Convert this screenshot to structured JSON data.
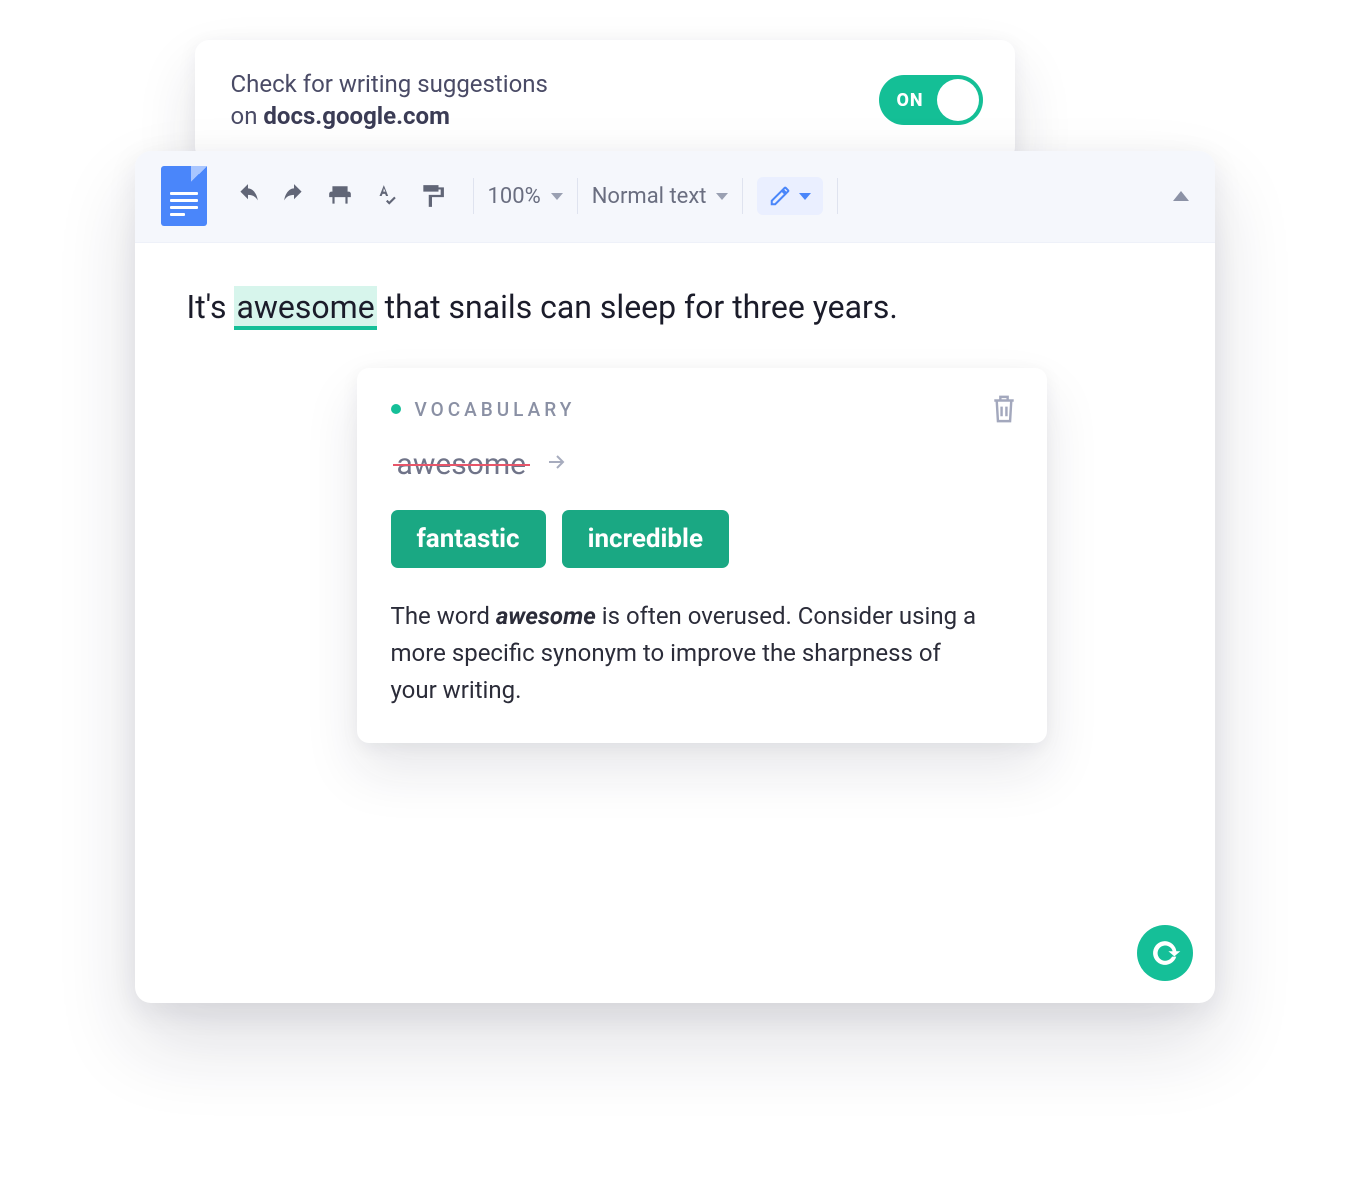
{
  "extension": {
    "prefix": "Check for writing suggestions",
    "on_word": "on",
    "domain": "docs.google.com",
    "toggle_label": "ON",
    "toggle_state": true
  },
  "toolbar": {
    "zoom": "100%",
    "style": "Normal text"
  },
  "document": {
    "sentence_before": "It's ",
    "highlighted_word": "awesome",
    "sentence_after": " that snails can sleep for three years."
  },
  "suggestion": {
    "category": "VOCABULARY",
    "original_word": "awesome",
    "replacements": [
      "fantastic",
      "incredible"
    ],
    "explanation_prefix": "The word ",
    "explanation_keyword": "awesome",
    "explanation_suffix": " is often overused. Consider using a more specific synonym to improve the sharpness of your writing."
  }
}
